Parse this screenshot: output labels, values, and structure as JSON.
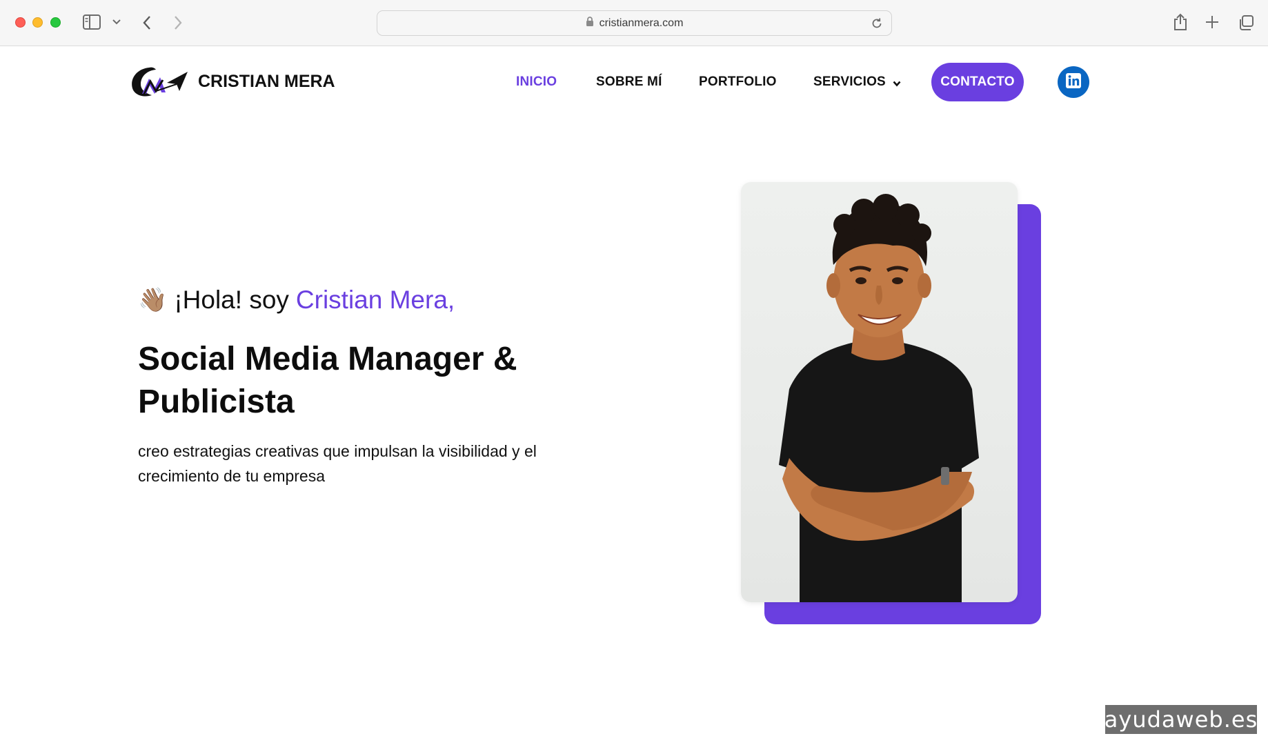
{
  "browser": {
    "url": "cristianmera.com"
  },
  "site": {
    "brand": "CRISTIAN MERA",
    "nav": {
      "inicio": "INICIO",
      "sobre_mi": "SOBRE MÍ",
      "portfolio": "PORTFOLIO",
      "servicios": "SERVICIOS",
      "contacto": "CONTACTO"
    }
  },
  "hero": {
    "wave_emoji": "👋🏽",
    "greeting_prefix": "¡Hola! soy",
    "greeting_name": "Cristian Mera,",
    "headline": "Social Media Manager & Publicista",
    "subtitle": "creo estrategias creativas que impulsan la visibilidad y el crecimiento de tu empresa"
  },
  "watermark": "ayudaweb.es",
  "colors": {
    "accent": "#6a3fe0",
    "linkedin": "#0a66c2"
  }
}
